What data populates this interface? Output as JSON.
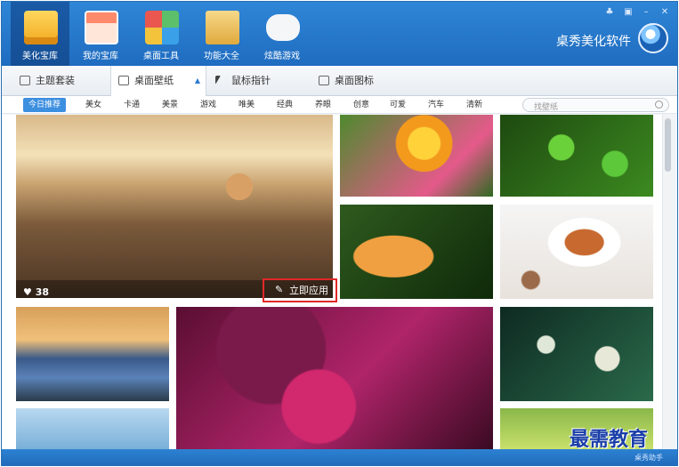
{
  "nav": {
    "items": [
      {
        "label": "美化宝库",
        "active": true
      },
      {
        "label": "我的宝库"
      },
      {
        "label": "桌面工具"
      },
      {
        "label": "功能大全"
      },
      {
        "label": "炫酷游戏"
      }
    ]
  },
  "brand": "桌秀美化软件",
  "tabs": [
    {
      "label": "主题套装"
    },
    {
      "label": "桌面壁纸",
      "active": true
    },
    {
      "label": "鼠标指针"
    },
    {
      "label": "桌面图标"
    }
  ],
  "categories": [
    "今日推荐",
    "美女",
    "卡通",
    "美景",
    "游戏",
    "唯美",
    "经典",
    "养眼",
    "创意",
    "可爱",
    "汽车",
    "清新"
  ],
  "search": {
    "placeholder": "找壁纸"
  },
  "featured": {
    "likes": "38",
    "apply_label": "立即应用"
  },
  "watermark": {
    "text": "最需教育",
    "sub": "桌秀助手"
  },
  "colors": {
    "accent": "#2f86d6",
    "highlight": "#e02828"
  }
}
